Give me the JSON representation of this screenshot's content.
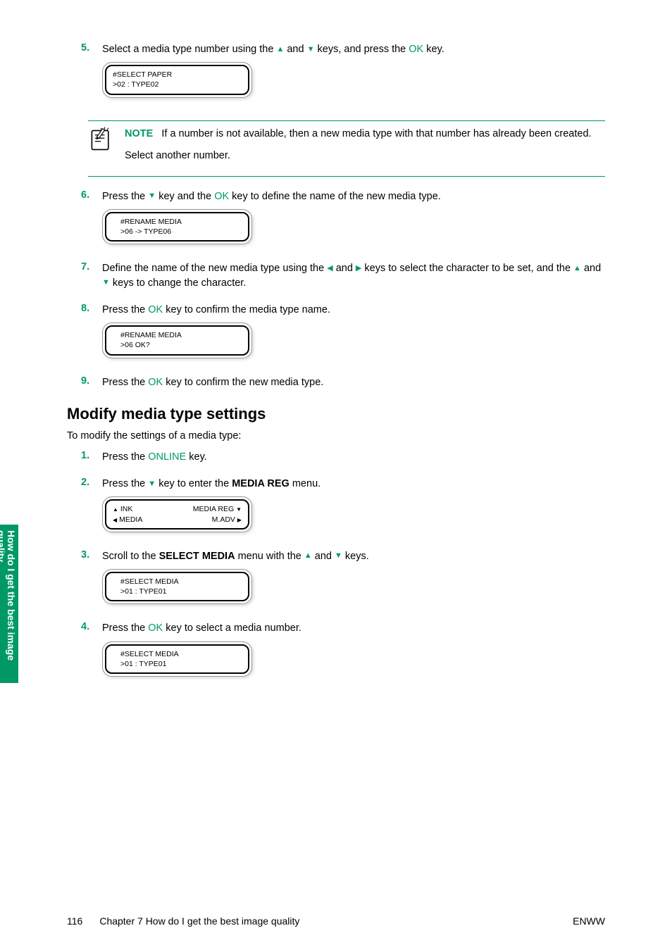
{
  "side_tab": {
    "line1": "How do I get the best image",
    "line2": "quality"
  },
  "steps_top": [
    {
      "num": "5.",
      "text_pre": "Select a media type number using the ",
      "text_mid": " and ",
      "text_post": " keys, and press the ",
      "text_end": " key.",
      "ok": "OK",
      "lcd": {
        "l1": "#SELECT PAPER",
        "l2": ">02 : TYPE02"
      }
    }
  ],
  "note": {
    "label": "NOTE",
    "text1": "If a number is not available, then a new media type with that number has already been created.",
    "text2": "Select another number."
  },
  "steps_mid": [
    {
      "num": "6.",
      "text_pre": "Press the ",
      "text_mid": " key and the ",
      "text_post": " key to define the name of the new media type.",
      "ok": "OK",
      "lcd": {
        "l1": "#RENAME MEDIA",
        "l2": ">06 -> TYPE06"
      }
    }
  ],
  "step7": {
    "num": "7.",
    "t1": "Define the name of the new media type using the ",
    "t2": " and ",
    "t3": " keys to select the character to be set, and the ",
    "t4": " and ",
    "t5": " keys to change the character."
  },
  "step8": {
    "num": "8.",
    "t1": "Press the ",
    "ok": "OK",
    "t2": " key to confirm the media type name.",
    "lcd": {
      "l1": "#RENAME MEDIA",
      "l2": ">06 OK?"
    }
  },
  "step9": {
    "num": "9.",
    "t1": "Press the ",
    "ok": "OK",
    "t2": " key to confirm the new media type."
  },
  "section_heading": "Modify media type settings",
  "section_lead": "To modify the settings of a media type:",
  "mod_steps": {
    "s1": {
      "num": "1.",
      "t1": "Press the ",
      "key": "ONLINE",
      "t2": " key."
    },
    "s2": {
      "num": "2.",
      "t1": "Press the ",
      "t2": " key to enter the ",
      "bold": "MEDIA REG",
      "t3": " menu.",
      "lcd": {
        "row1_left": "INK",
        "row1_right": "MEDIA REG",
        "row2_left": "MEDIA",
        "row2_right": "M.ADV"
      }
    },
    "s3": {
      "num": "3.",
      "t1": "Scroll to the ",
      "bold": "SELECT MEDIA",
      "t2": " menu with the ",
      "t3": " and ",
      "t4": " keys.",
      "lcd": {
        "l1": "#SELECT MEDIA",
        "l2": ">01 : TYPE01"
      }
    },
    "s4": {
      "num": "4.",
      "t1": "Press the ",
      "ok": "OK",
      "t2": " key to select a media number.",
      "lcd": {
        "l1": "#SELECT MEDIA",
        "l2": ">01 : TYPE01"
      }
    }
  },
  "footer": {
    "pagenum": "116",
    "chapter": "Chapter 7   How do I get the best image quality",
    "right": "ENWW"
  }
}
